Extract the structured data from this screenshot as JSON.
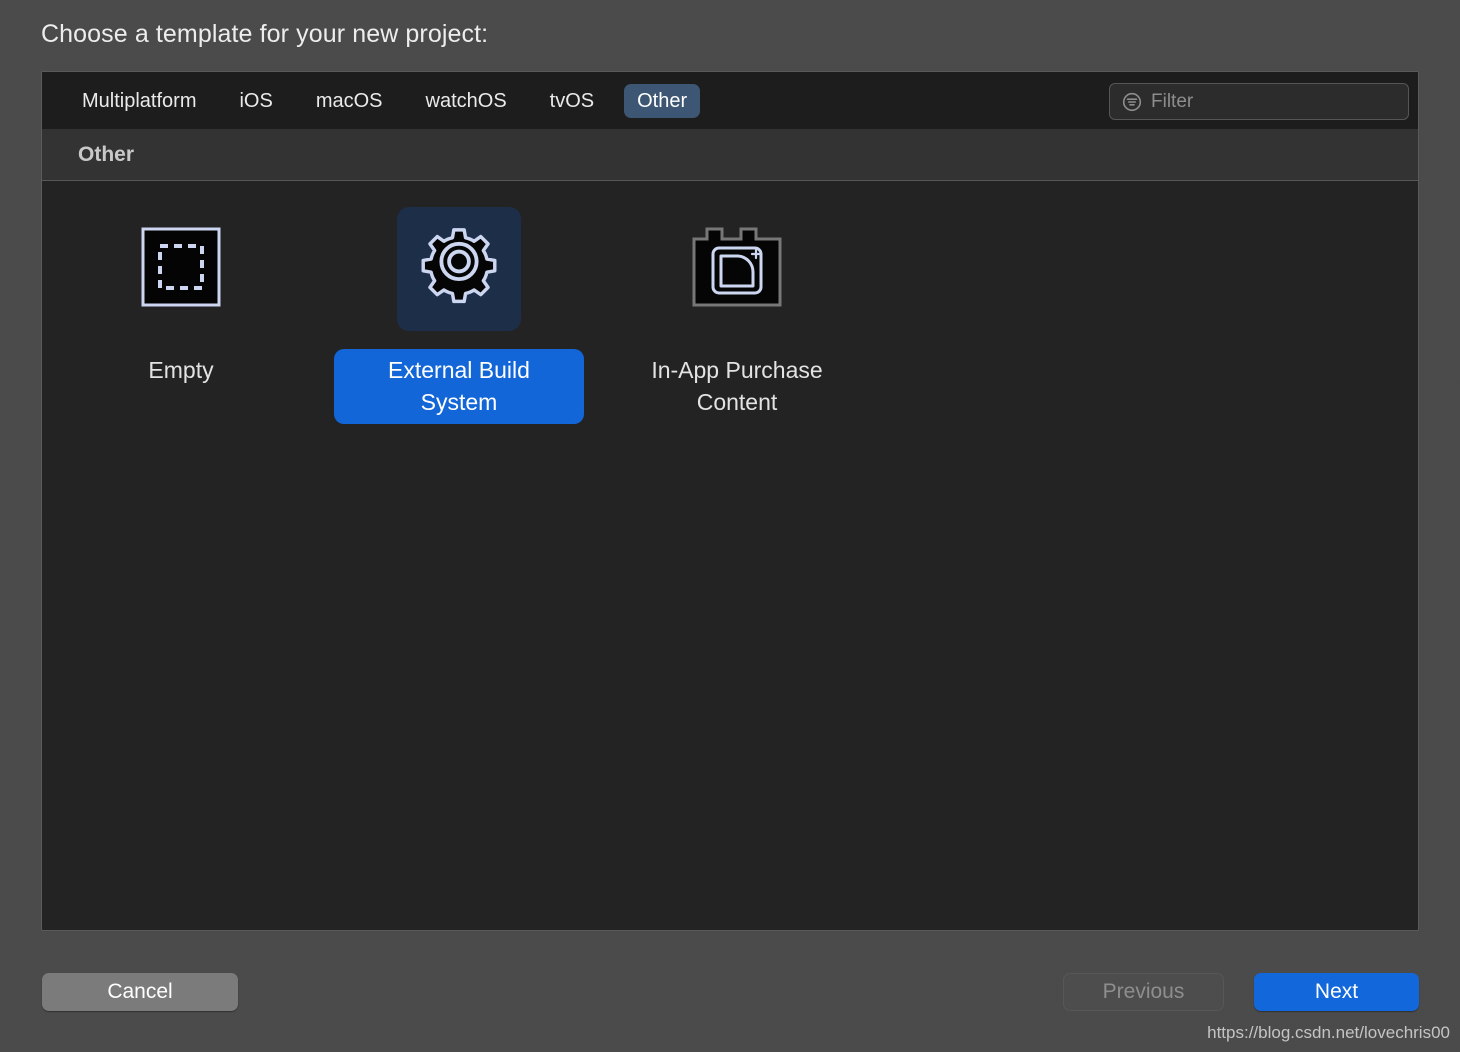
{
  "dialog": {
    "title": "Choose a template for your new project:"
  },
  "tabs": {
    "items": [
      {
        "label": "Multiplatform",
        "selected": false,
        "name": "tab-multiplatform"
      },
      {
        "label": "iOS",
        "selected": false,
        "name": "tab-ios"
      },
      {
        "label": "macOS",
        "selected": false,
        "name": "tab-macos"
      },
      {
        "label": "watchOS",
        "selected": false,
        "name": "tab-watchos"
      },
      {
        "label": "tvOS",
        "selected": false,
        "name": "tab-tvos"
      },
      {
        "label": "Other",
        "selected": true,
        "name": "tab-other"
      }
    ],
    "selected_label": "Other"
  },
  "filter": {
    "value": "",
    "placeholder": "Filter",
    "icon": "filter-icon"
  },
  "section": {
    "header_label": "Other"
  },
  "templates": [
    {
      "label": "Empty",
      "icon": "empty-template-icon",
      "selected": false,
      "name": "template-empty"
    },
    {
      "label": "External Build System",
      "icon": "gear-icon",
      "selected": true,
      "name": "template-external-build-system"
    },
    {
      "label": "In-App Purchase Content",
      "icon": "in-app-purchase-icon",
      "selected": false,
      "name": "template-in-app-purchase-content"
    }
  ],
  "buttons": {
    "cancel": "Cancel",
    "previous": "Previous",
    "next": "Next"
  },
  "watermark": {
    "text": "https://blog.csdn.net/lovechris00"
  },
  "colors": {
    "accent_blue": "#1268da",
    "selected_tab": "#3d5673",
    "selected_icon_bg": "#1d2e49",
    "panel_bg": "#232323",
    "tabbar_bg": "#1d1d1d",
    "section_header_bg": "#333333",
    "dialog_bg": "#4a4a4a",
    "icon_outline": "#ccd6f0"
  }
}
